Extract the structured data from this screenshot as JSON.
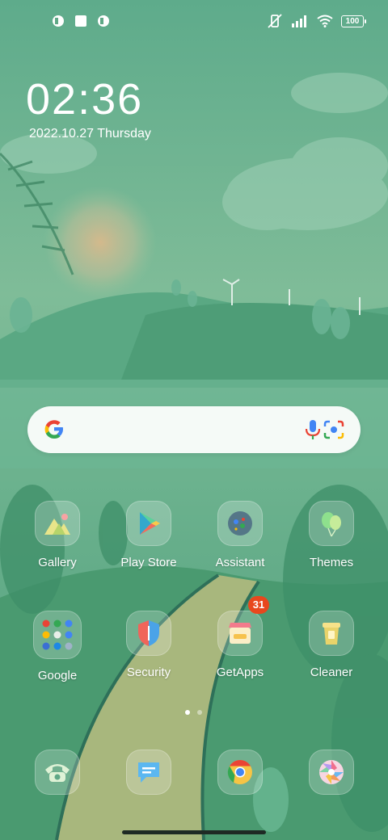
{
  "status_bar": {
    "left_icons": [
      "notification-icon-1",
      "square-notification-icon",
      "notification-icon-2"
    ],
    "right_icons": [
      "vibrate-mute-icon",
      "signal-icon",
      "wifi-icon"
    ],
    "battery": "100"
  },
  "clock": {
    "time": "02:36",
    "date": "2022.10.27 Thursday"
  },
  "search": {
    "icons": [
      "google-g-icon",
      "microphone-icon",
      "camera-lens-icon"
    ]
  },
  "apps": {
    "gallery": "Gallery",
    "play_store": "Play Store",
    "assistant": "Assistant",
    "themes": "Themes",
    "google": "Google",
    "security": "Security",
    "getapps": "GetApps",
    "getapps_badge": "31",
    "cleaner": "Cleaner"
  },
  "dock": [
    "phone-icon",
    "messages-icon",
    "chrome-icon",
    "camera-icon"
  ],
  "page_indicator": {
    "pages": 2,
    "active": 1
  }
}
